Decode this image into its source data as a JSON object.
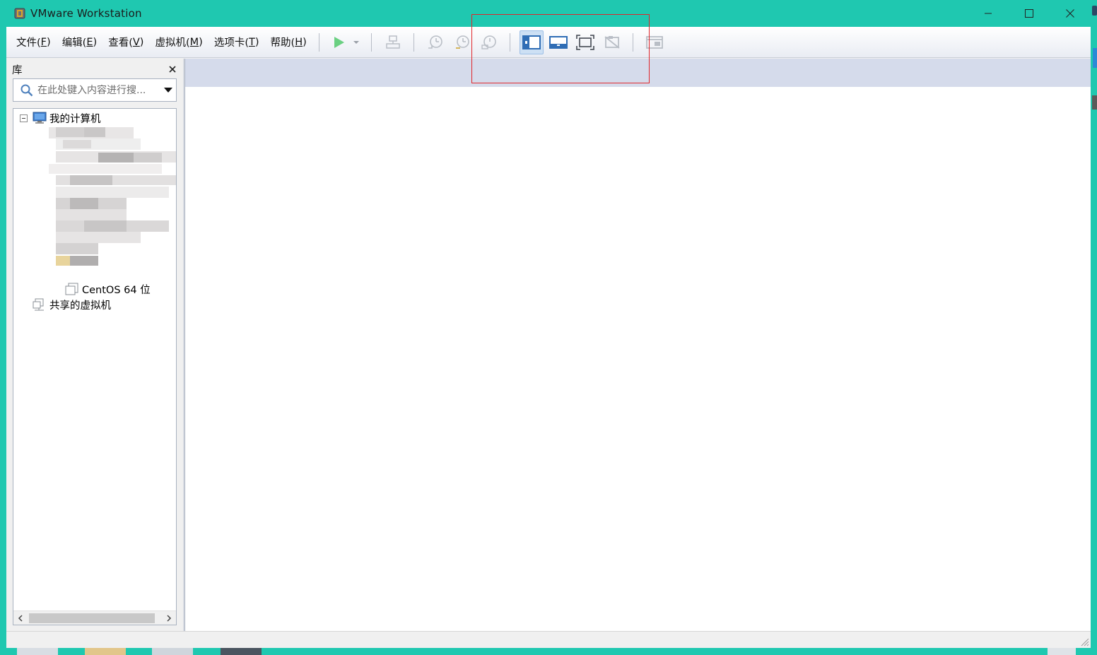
{
  "window": {
    "title": "VMware Workstation"
  },
  "menu": [
    {
      "label": "文件(",
      "key": "F",
      "suffix": ")"
    },
    {
      "label": "编辑(",
      "key": "E",
      "suffix": ")"
    },
    {
      "label": "查看(",
      "key": "V",
      "suffix": ")"
    },
    {
      "label": "虚拟机(",
      "key": "M",
      "suffix": ")"
    },
    {
      "label": "选项卡(",
      "key": "T",
      "suffix": ")"
    },
    {
      "label": "帮助(",
      "key": "H",
      "suffix": ")"
    }
  ],
  "toolbar": {
    "active_view": "show-library",
    "accent_color": "#2f6db5",
    "play_color": "#2cb24a",
    "highlight_color": "#e0262b"
  },
  "library": {
    "title": "库",
    "search_placeholder": "在此处键入内容进行搜...",
    "tree": {
      "root_label": "我的计算机",
      "vm_label": "CentOS 64 位",
      "shared_label": "共享的虚拟机"
    }
  },
  "colors": {
    "titlebar": "#1fc8b0",
    "tabstrip": "#d5dbeb"
  }
}
